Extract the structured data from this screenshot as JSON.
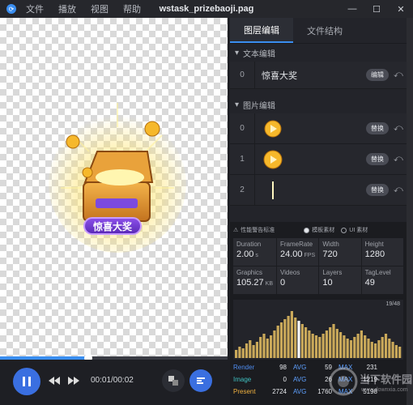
{
  "titlebar": {
    "menu": [
      "文件",
      "播放",
      "视图",
      "帮助"
    ],
    "title": "wstask_prizebaoji.pag"
  },
  "canvas": {
    "banner_text": "惊喜大奖"
  },
  "player": {
    "time": "00:01/00:02",
    "progress": 0.38
  },
  "tabs": [
    "图层编辑",
    "文件结构"
  ],
  "text_section": {
    "title": "文本编辑",
    "rows": [
      {
        "index": "0",
        "label": "惊喜大奖",
        "button": "编辑"
      }
    ]
  },
  "image_section": {
    "title": "图片编辑",
    "rows": [
      {
        "index": "0",
        "button": "替换"
      },
      {
        "index": "1",
        "button": "替换"
      },
      {
        "index": "2",
        "button": "替换"
      }
    ]
  },
  "perf": {
    "warning": "性能警告标准",
    "option_1": "模板素材",
    "option_2": "UI 素材",
    "stats": [
      {
        "label": "Duration",
        "value": "2.00",
        "unit": "s"
      },
      {
        "label": "FrameRate",
        "value": "24.00",
        "unit": "FPS"
      },
      {
        "label": "Width",
        "value": "720",
        "unit": ""
      },
      {
        "label": "Height",
        "value": "1280",
        "unit": ""
      },
      {
        "label": "Graphics",
        "value": "105.27",
        "unit": "KB"
      },
      {
        "label": "Videos",
        "value": "0",
        "unit": ""
      },
      {
        "label": "Layers",
        "value": "10",
        "unit": ""
      },
      {
        "label": "TagLevel",
        "value": "49",
        "unit": ""
      }
    ],
    "frame_count": "19/48",
    "rows": [
      {
        "name": "Render",
        "color": "#4f8df0",
        "value": "98",
        "avg": "59",
        "max": "231"
      },
      {
        "name": "Image",
        "color": "#3fc0c0",
        "value": "0",
        "avg": "26",
        "max": "1219"
      },
      {
        "name": "Present",
        "color": "#f0b13f",
        "value": "2724",
        "avg": "1760",
        "max": "5198"
      }
    ],
    "avg_label": "AVG",
    "max_label": "MAX"
  },
  "watermark": {
    "text": "当下软件园",
    "sub": "www.downxia.com"
  }
}
